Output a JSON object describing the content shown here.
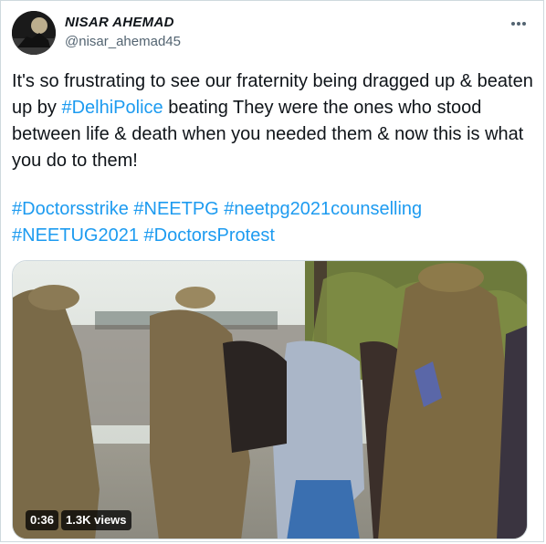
{
  "author": {
    "name": "NISAR AHEMAD",
    "handle": "@nisar_ahemad45"
  },
  "tweet": {
    "text_part1": "It's so frustrating to see our fraternity being dragged up & beaten up by ",
    "mention": "#DelhiPolice",
    "text_part2": " beating They were the ones who stood between life & death when you needed them & now this is what you do to them!",
    "hashtags": [
      "#Doctorsstrike",
      "#NEETPG",
      "#neetpg2021counselling",
      "#NEETUG2021",
      "#DoctorsProtest"
    ]
  },
  "video": {
    "duration": "0:36",
    "views": "1.3K views"
  },
  "icons": {
    "more": "more-options-icon"
  },
  "colors": {
    "link": "#1d9bf0",
    "text": "#0f1419",
    "secondary": "#536471"
  }
}
